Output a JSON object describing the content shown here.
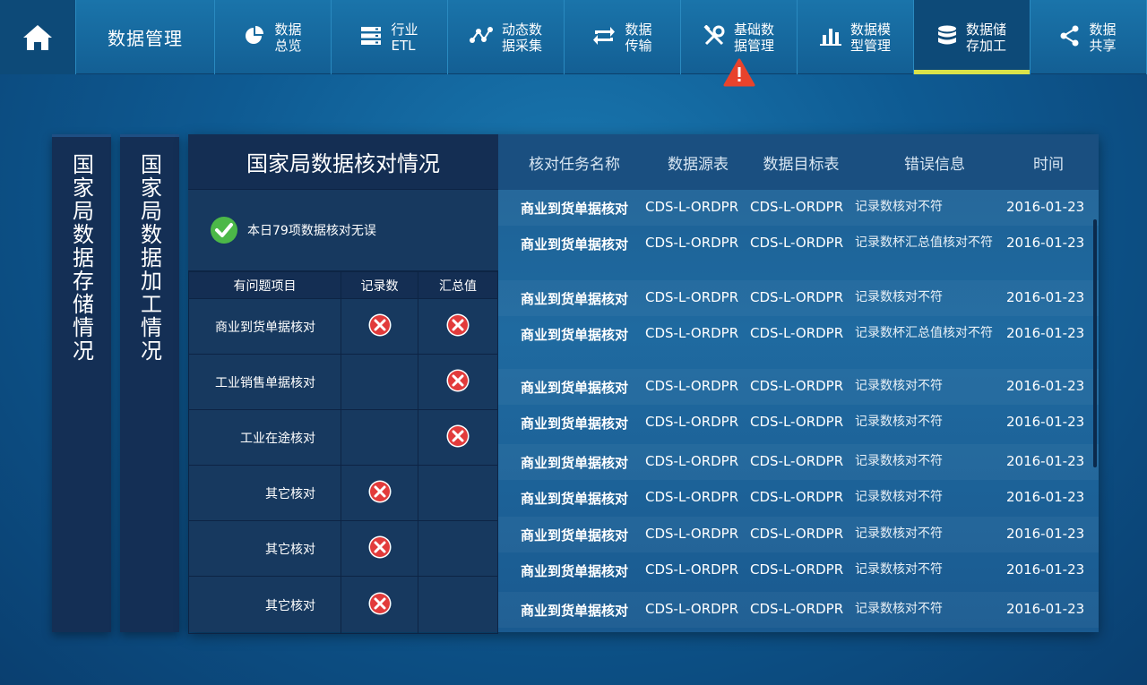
{
  "nav": {
    "title": "数据管理",
    "items": [
      {
        "line1": "数据",
        "line2": "总览",
        "icon": "pie-chart-icon"
      },
      {
        "line1": "行业",
        "line2": "ETL",
        "icon": "server-icon"
      },
      {
        "line1": "动态数",
        "line2": "据采集",
        "icon": "graph-nodes-icon"
      },
      {
        "line1": "数据",
        "line2": "传输",
        "icon": "transfer-icon"
      },
      {
        "line1": "基础数",
        "line2": "据管理",
        "icon": "tools-icon"
      },
      {
        "line1": "数据模",
        "line2": "型管理",
        "icon": "bar-chart-icon"
      },
      {
        "line1": "数据储",
        "line2": "存加工",
        "icon": "database-icon"
      },
      {
        "line1": "数据",
        "line2": "共享",
        "icon": "share-icon"
      }
    ],
    "active_index": 6,
    "alert_index": 4
  },
  "side_tabs": [
    "国家局数据存储情况",
    "国家局数据加工情况"
  ],
  "summary": {
    "title": "国家局数据核对情况",
    "ok_text": "本日79项数据核对无误",
    "headers": [
      "有问题项目",
      "记录数",
      "汇总值"
    ],
    "rows": [
      {
        "name": "商业到货单据核对",
        "records": true,
        "totals": true
      },
      {
        "name": "工业销售单据核对",
        "records": false,
        "totals": true
      },
      {
        "name": "工业在途核对",
        "records": false,
        "totals": true
      },
      {
        "name": "其它核对",
        "records": true,
        "totals": false
      },
      {
        "name": "其它核对",
        "records": true,
        "totals": false
      },
      {
        "name": "其它核对",
        "records": true,
        "totals": false
      }
    ]
  },
  "detail": {
    "headers": [
      "核对任务名称",
      "数据源表",
      "数据目标表",
      "错误信息",
      "时间"
    ],
    "rows": [
      {
        "task": "商业到货单据核对",
        "src": "CDS-L-ORDPR",
        "dst": "CDS-L-ORDPR",
        "err": "记录数核对不符",
        "time": "2016-01-23"
      },
      {
        "task": "商业到货单据核对",
        "src": "CDS-L-ORDPR",
        "dst": "CDS-L-ORDPR",
        "err": "记录数杯汇总值核对不符",
        "time": "2016-01-23"
      },
      {
        "task": "商业到货单据核对",
        "src": "CDS-L-ORDPR",
        "dst": "CDS-L-ORDPR",
        "err": "记录数核对不符",
        "time": "2016-01-23"
      },
      {
        "task": "商业到货单据核对",
        "src": "CDS-L-ORDPR",
        "dst": "CDS-L-ORDPR",
        "err": "记录数杯汇总值核对不符",
        "time": "2016-01-23"
      },
      {
        "task": "商业到货单据核对",
        "src": "CDS-L-ORDPR",
        "dst": "CDS-L-ORDPR",
        "err": "记录数核对不符",
        "time": "2016-01-23"
      },
      {
        "task": "商业到货单据核对",
        "src": "CDS-L-ORDPR",
        "dst": "CDS-L-ORDPR",
        "err": "记录数核对不符",
        "time": "2016-01-23"
      },
      {
        "task": "商业到货单据核对",
        "src": "CDS-L-ORDPR",
        "dst": "CDS-L-ORDPR",
        "err": "记录数核对不符",
        "time": "2016-01-23"
      },
      {
        "task": "商业到货单据核对",
        "src": "CDS-L-ORDPR",
        "dst": "CDS-L-ORDPR",
        "err": "记录数核对不符",
        "time": "2016-01-23"
      },
      {
        "task": "商业到货单据核对",
        "src": "CDS-L-ORDPR",
        "dst": "CDS-L-ORDPR",
        "err": "记录数核对不符",
        "time": "2016-01-23"
      },
      {
        "task": "商业到货单据核对",
        "src": "CDS-L-ORDPR",
        "dst": "CDS-L-ORDPR",
        "err": "记录数核对不符",
        "time": "2016-01-23"
      },
      {
        "task": "商业到货单据核对",
        "src": "CDS-L-ORDPR",
        "dst": "CDS-L-ORDPR",
        "err": "记录数核对不符",
        "time": "2016-01-23"
      }
    ]
  },
  "colors": {
    "accent": "#d9e24a",
    "error": "#e23b3b",
    "ok": "#4cb848",
    "alert": "#e8432c"
  }
}
